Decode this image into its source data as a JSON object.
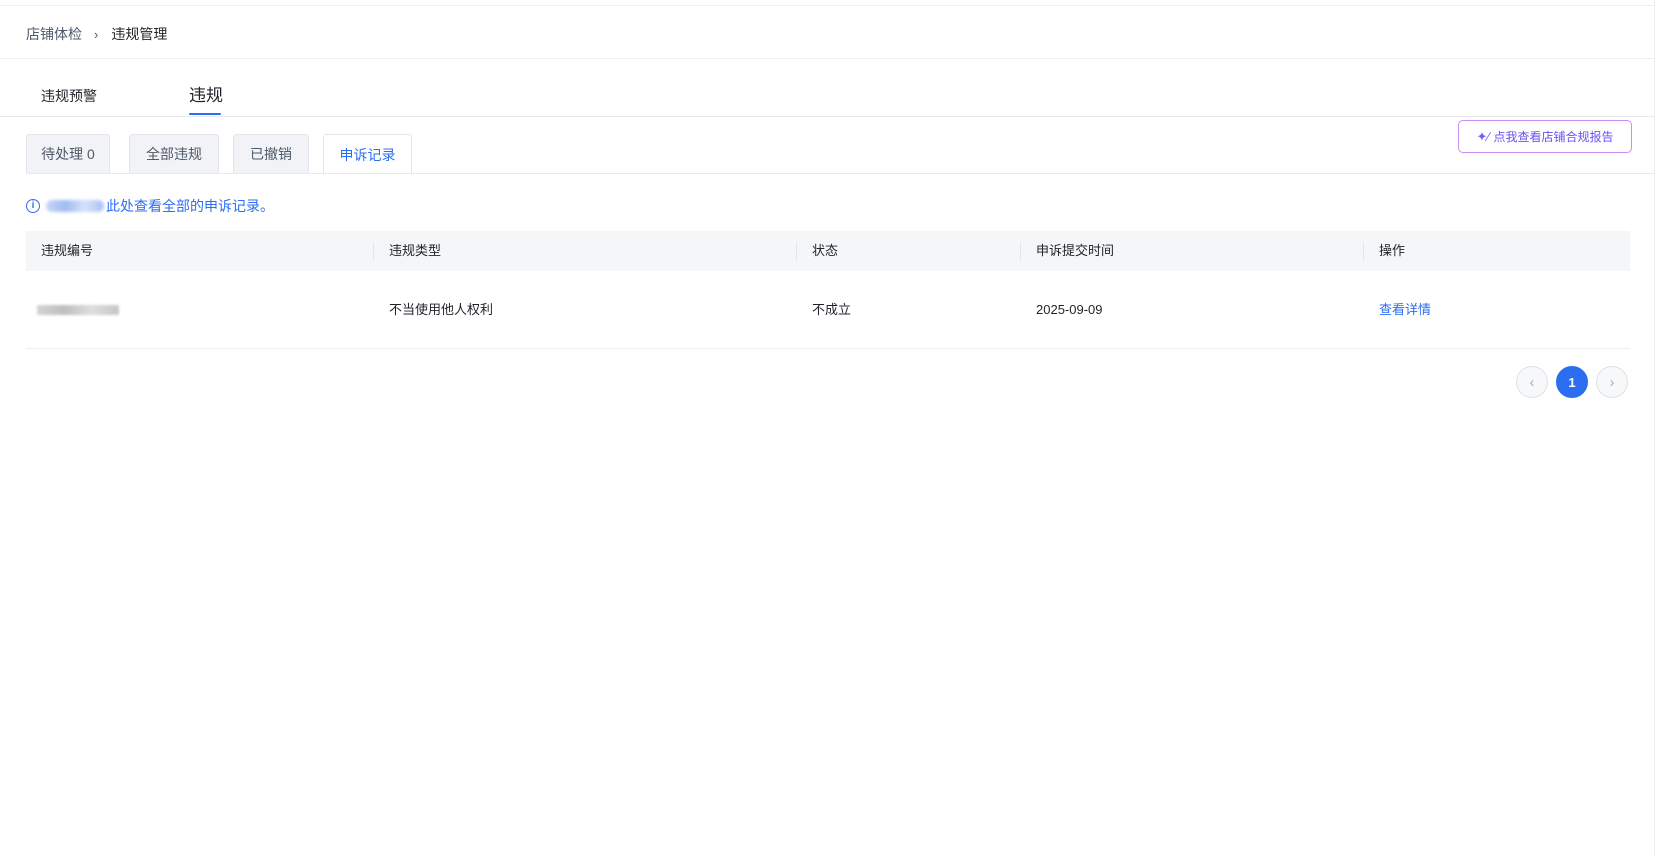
{
  "breadcrumb": {
    "parent": "店铺体检",
    "separator": "›",
    "current": "违规管理"
  },
  "main_tabs": [
    {
      "label": "违规预警"
    },
    {
      "label": "违规"
    }
  ],
  "report_button": {
    "icon": "sparkle-icon",
    "label": "点我查看店铺合规报告"
  },
  "sub_tabs": [
    {
      "label": "待处理 0"
    },
    {
      "label": "全部违规"
    },
    {
      "label": "已撤销"
    },
    {
      "label": "申诉记录"
    }
  ],
  "notice": {
    "icon": "info",
    "text": "此处查看全部的申诉记录。"
  },
  "table": {
    "columns": [
      "违规编号",
      "违规类型",
      "状态",
      "申诉提交时间",
      "操作"
    ],
    "rows": [
      {
        "id": "",
        "type": "不当使用他人权利",
        "status": "不成立",
        "submitted": "2025-09-09",
        "action": "查看详情"
      }
    ]
  },
  "pagination": {
    "prev": "‹",
    "current_page": "1",
    "next": "›"
  },
  "colors": {
    "accent": "#2c6ef2",
    "report_border": "#c78ef0",
    "report_text": "#6e4ff0"
  }
}
